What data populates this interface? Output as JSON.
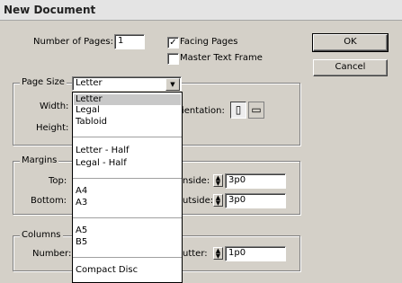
{
  "window": {
    "title": "New Document"
  },
  "pages": {
    "label": "Number of Pages:",
    "value": "1"
  },
  "facing": {
    "label": "Facing Pages",
    "checked": true,
    "mark": "✓"
  },
  "master": {
    "label": "Master Text Frame",
    "checked": false
  },
  "buttons": {
    "ok": "OK",
    "cancel": "Cancel"
  },
  "page_size": {
    "group_title": "Page Size",
    "selected": "Letter",
    "width_label": "Width:",
    "height_label": "Height:",
    "orientation_label": "Orientation:",
    "orientation_visible": "ientation:",
    "options": [
      {
        "label": "Letter",
        "selected": true
      },
      {
        "label": "Legal"
      },
      {
        "label": "Tabloid"
      },
      {
        "label": "Letter - Half"
      },
      {
        "label": "Legal - Half"
      },
      {
        "label": "A4"
      },
      {
        "label": "A3"
      },
      {
        "label": "A5"
      },
      {
        "label": "B5"
      },
      {
        "label": "Compact Disc"
      }
    ]
  },
  "margins": {
    "group_title": "Margins",
    "top_label": "Top:",
    "bottom_label": "Bottom:",
    "inside_label": "Inside:",
    "outside_label": "Outside:",
    "inside_visible": "nside:",
    "outside_visible": "utside:",
    "inside_value": "3p0",
    "outside_value": "3p0"
  },
  "columns": {
    "group_title": "Columns",
    "number_label": "Number:",
    "gutter_label": "Gutter:",
    "gutter_visible": "utter:",
    "gutter_value": "1p0"
  }
}
